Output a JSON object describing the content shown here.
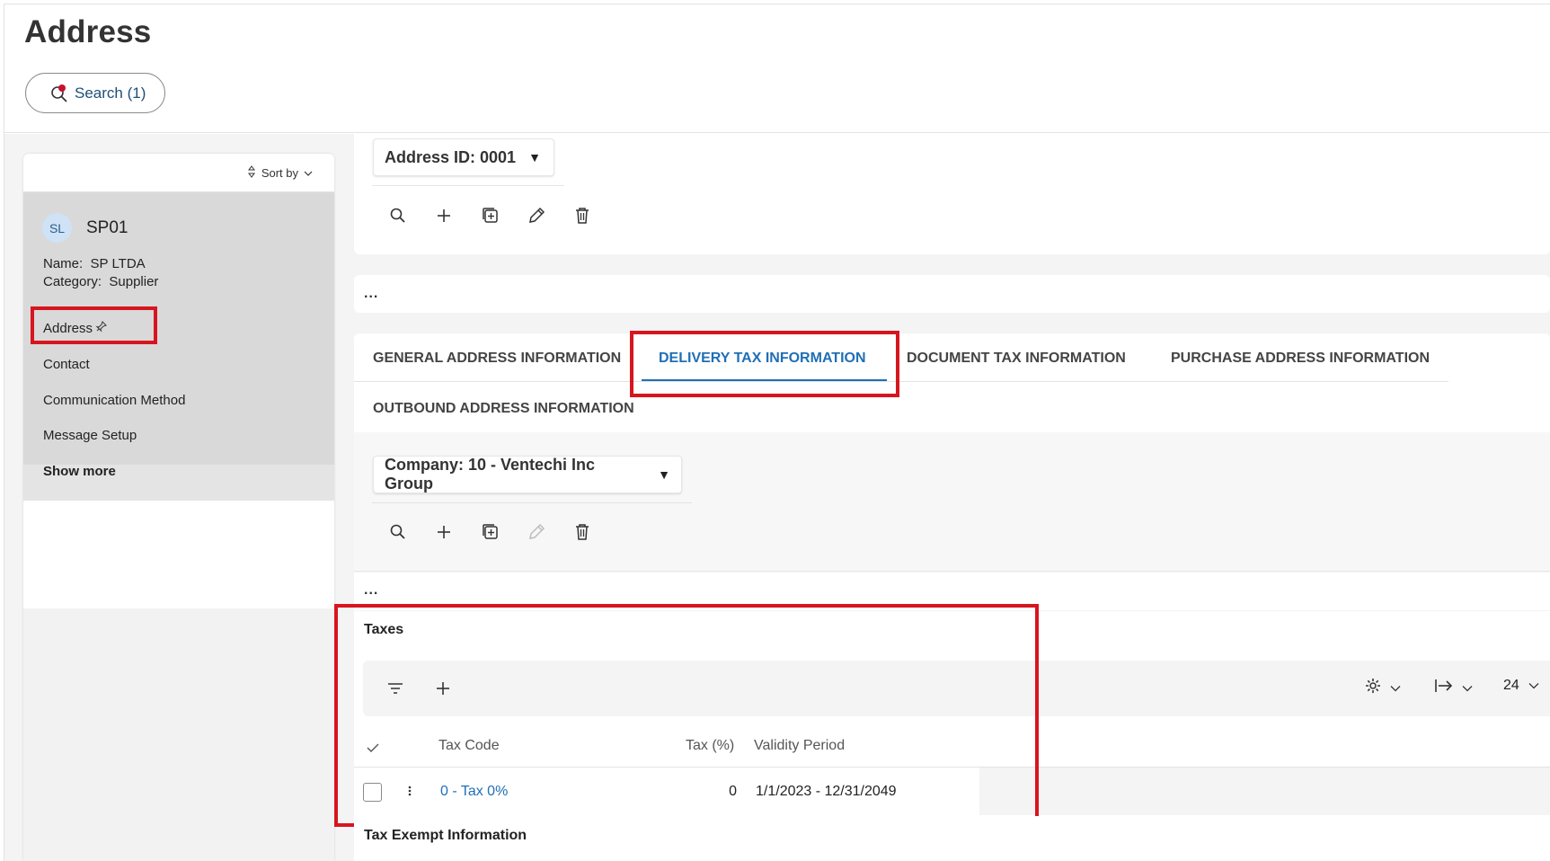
{
  "header": {
    "title": "Address",
    "search_label": "Search (1)"
  },
  "left_panel": {
    "sort_label": "Sort by",
    "record": {
      "initials": "SL",
      "id": "SP01",
      "name_label": "Name:",
      "name_value": "SP LTDA",
      "category_label": "Category:",
      "category_value": "Supplier"
    },
    "nav": [
      {
        "label": "Address"
      },
      {
        "label": "Contact"
      },
      {
        "label": "Communication Method"
      },
      {
        "label": "Message Setup"
      },
      {
        "label": "Show more"
      }
    ]
  },
  "address_selector": {
    "label": "Address ID: 0001"
  },
  "ellipsis": "...",
  "tabs": [
    {
      "label": "GENERAL ADDRESS INFORMATION"
    },
    {
      "label": "DELIVERY TAX INFORMATION"
    },
    {
      "label": "DOCUMENT TAX INFORMATION"
    },
    {
      "label": "PURCHASE ADDRESS INFORMATION"
    },
    {
      "label": "OUTBOUND ADDRESS INFORMATION"
    }
  ],
  "company_selector": {
    "label": "Company: 10 - Ventechi Inc Group"
  },
  "taxes": {
    "title": "Taxes",
    "page_size": "24",
    "columns": {
      "tax_code": "Tax Code",
      "tax_pct": "Tax (%)",
      "validity": "Validity Period"
    },
    "rows": [
      {
        "tax_code": "0 - Tax 0%",
        "tax_pct": "0",
        "validity": "1/1/2023 - 12/31/2049"
      }
    ]
  },
  "tax_exempt": {
    "title": "Tax Exempt Information"
  },
  "colors": {
    "accent": "#1f6fb5",
    "highlight": "#d7151f",
    "alert_dot": "#c8102e"
  }
}
